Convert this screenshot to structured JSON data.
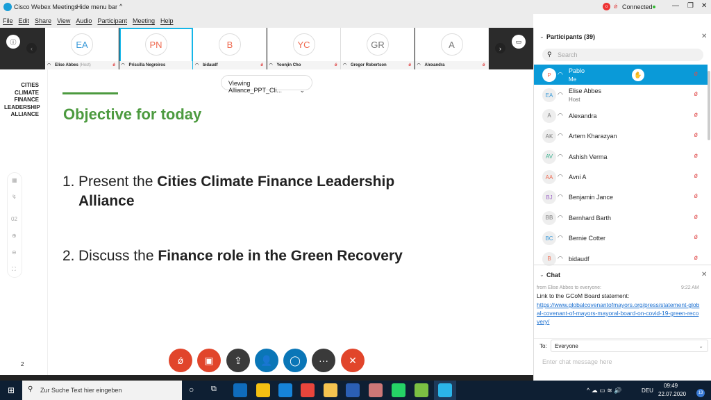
{
  "app": {
    "title": "Cisco Webex Meetings",
    "hide_menu": "Hide menu bar",
    "status": "Connected"
  },
  "menu": [
    "File",
    "Edit",
    "Share",
    "View",
    "Audio",
    "Participant",
    "Meeting",
    "Help"
  ],
  "video_tiles": [
    {
      "initials": "EA",
      "name": "Elise Abbes",
      "role": "(Host)",
      "color": "#3a9ad9"
    },
    {
      "initials": "PN",
      "name": "Priscilla Negreiros",
      "color": "#ef6a50"
    },
    {
      "initials": "B",
      "name": "bidaudf",
      "color": "#ef6a50"
    },
    {
      "initials": "YC",
      "name": "Yoonjin Cho",
      "color": "#ef6a50"
    },
    {
      "initials": "GR",
      "name": "Gregor Robertson",
      "color": "#777777"
    },
    {
      "initials": "A",
      "name": "Alexandra",
      "color": "#777777"
    }
  ],
  "viewing": "Viewing Alliance_PPT_Cli...",
  "slide": {
    "logo": [
      "CITIES CLIMATE",
      "FINANCE",
      "LEADERSHIP",
      "ALLIANCE"
    ],
    "title": "Objective for today",
    "item1_num": "1.",
    "item1_pre": "Present the ",
    "item1_bold": "Cities Climate Finance Leadership Alliance",
    "item2_num": "2.",
    "item2_pre": "Discuss the ",
    "item2_bold": "Finance role in the Green Recovery",
    "page": "2",
    "accent": "#4c9a3f"
  },
  "toolbar": {
    "page": "02"
  },
  "participants": {
    "header": "Participants (39)",
    "search_placeholder": "Search",
    "items": [
      {
        "initials": "P",
        "name": "Pablo",
        "sub": "Me",
        "color": "#ef6a50"
      },
      {
        "initials": "EA",
        "name": "Elise Abbes",
        "sub": "Host",
        "color": "#3a9ad9"
      },
      {
        "initials": "A",
        "name": "Alexandra",
        "color": "#777777"
      },
      {
        "initials": "AK",
        "name": "Artem Kharazyan",
        "color": "#777777"
      },
      {
        "initials": "AV",
        "name": "Ashish Verma",
        "color": "#3bb08f"
      },
      {
        "initials": "AA",
        "name": "Avni A",
        "color": "#ef6a50"
      },
      {
        "initials": "BJ",
        "name": "Benjamin Jance",
        "color": "#a06ac8"
      },
      {
        "initials": "BB",
        "name": "Bernhard Barth",
        "color": "#777777"
      },
      {
        "initials": "BC",
        "name": "Bernie Cotter",
        "color": "#3a9ad9"
      },
      {
        "initials": "B",
        "name": "bidaudf",
        "color": "#ef6a50"
      }
    ]
  },
  "chat": {
    "header": "Chat",
    "from": "from Elise Abbes to everyone:",
    "time": "9:22 AM",
    "message": "Link to the GCoM Board statement:",
    "link": "https://www.globalcovenantofmayors.org/press/statement-global-covenant-of-mayors-mayoral-board-on-covid-19-green-recovery/",
    "to_label": "To:",
    "to_value": "Everyone",
    "placeholder": "Enter chat message here"
  },
  "taskbar": {
    "search": "Zur Suche Text hier eingeben",
    "lang": "DEU",
    "time": "09:49",
    "date": "22.07.2020",
    "notifications": "13"
  }
}
